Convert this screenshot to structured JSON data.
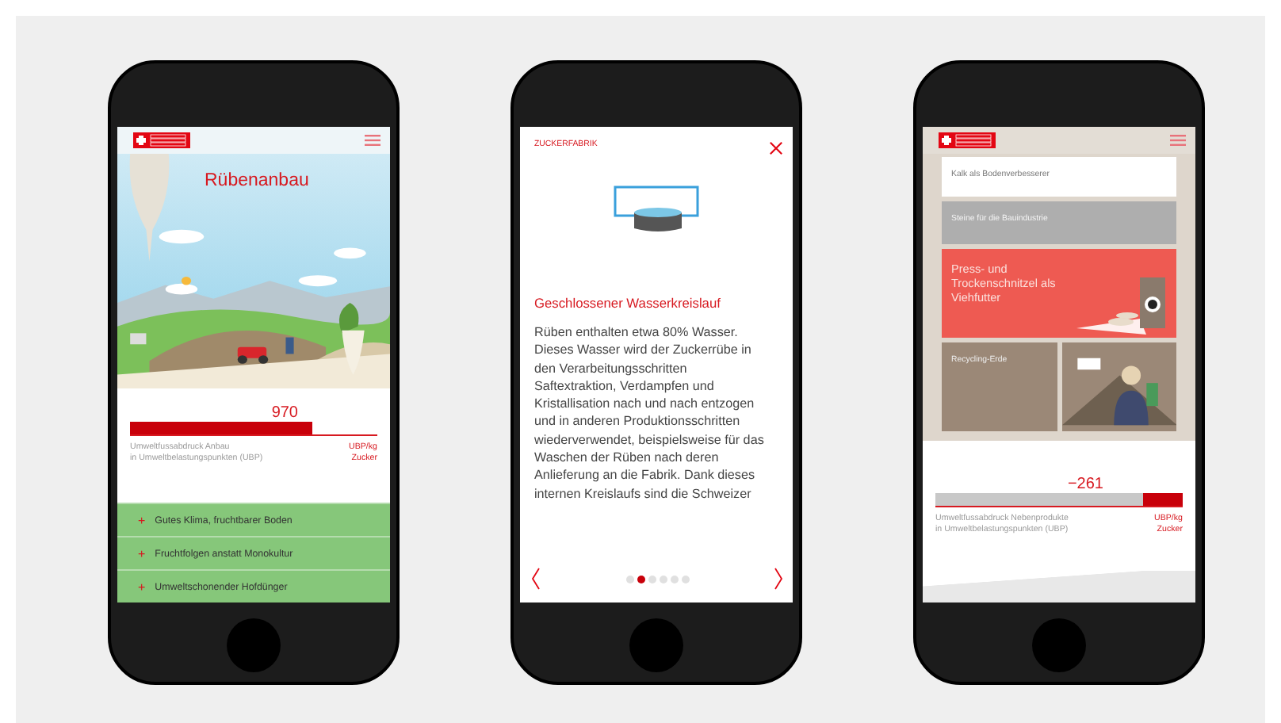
{
  "phones": [
    {
      "kind": "cultivation",
      "title": "Rübenanbau",
      "score": {
        "value": "970",
        "level": 0.74,
        "caption": [
          "Umweltfussabdruck Anbau",
          "in Umweltbelastungspunkten (UBP)"
        ],
        "unit": [
          "UBP/kg",
          "Zucker"
        ]
      },
      "items": [
        {
          "icon": "+",
          "label": "Gutes Klima, fruchtbarer Boden"
        },
        {
          "icon": "+",
          "label": "Fruchtfolgen anstatt Monokultur"
        },
        {
          "icon": "+",
          "label": "Umweltschonender Hofdünger"
        }
      ]
    },
    {
      "kind": "factory",
      "section": "ZUCKERFABRIK",
      "title": "Geschlossener Wasserkreislauf",
      "body": "Rüben enthalten etwa 80% Wasser. Dieses Wasser wird der Zuckerrübe in den Verarbeitungsschritten Saftextraktion, Verdampfen und Kristallisation nach und nach entzogen und in anderen Produktionsschritten wiederverwendet, beispielsweise für das Waschen der Rüben nach deren Anlieferung an die Fabrik. Dank dieses internen Kreislaufs sind die Schweizer",
      "pages": [
        {
          "selected": false
        },
        {
          "selected": true
        },
        {
          "selected": false
        },
        {
          "selected": false
        },
        {
          "selected": false
        },
        {
          "selected": false
        }
      ]
    },
    {
      "kind": "byproducts",
      "tiles": [
        {
          "kind": "plain",
          "label": "Kalk als Bodenverbesserer"
        },
        {
          "kind": "muted",
          "label": "Steine für die Bauindustrie"
        },
        {
          "kind": "highlight",
          "label": "Press- und Trockenschnitzel als Viehfutter"
        },
        {
          "kind": "earth",
          "label": "Recycling-Erde"
        },
        {
          "kind": "video"
        }
      ],
      "score": {
        "value": "−261",
        "level": 0.16,
        "caption": [
          "Umweltfussabdruck Nebenprodukte",
          "in Umweltbelastungspunkten (UBP)"
        ],
        "unit": [
          "UBP/kg",
          "Zucker"
        ]
      }
    }
  ]
}
